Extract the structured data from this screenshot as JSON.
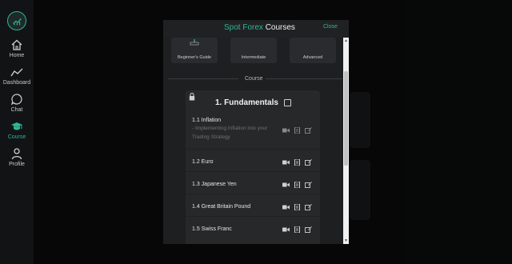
{
  "sidebar": {
    "items": [
      {
        "label": "Home",
        "icon": "home-icon"
      },
      {
        "label": "Dashboard",
        "icon": "chart-line-icon"
      },
      {
        "label": "Chat",
        "icon": "chat-bubble-icon"
      },
      {
        "label": "Course",
        "icon": "graduation-cap-icon",
        "active": true
      },
      {
        "label": "Profile",
        "icon": "user-icon"
      }
    ]
  },
  "modal": {
    "title_accent": "Spot Forex",
    "title_rest": " Courses",
    "close_label": "Close",
    "levels": [
      {
        "label": "Beginner's Guide"
      },
      {
        "label": "Intermediate"
      },
      {
        "label": "Advanced"
      }
    ],
    "section_label": "Course",
    "course": {
      "title": "1. Fundamentals",
      "lessons": [
        {
          "title": "1.1 Inflation",
          "subtitle": "- Implementing Inflation into your Trading Strategy"
        },
        {
          "title": "1.2 Euro",
          "subtitle": ""
        },
        {
          "title": "1.3 Japanese Yen",
          "subtitle": ""
        },
        {
          "title": "1.4 Great Britain Pound",
          "subtitle": ""
        },
        {
          "title": "1.5 Swiss Franc",
          "subtitle": ""
        }
      ]
    }
  },
  "colors": {
    "accent": "#2fb596",
    "background": "#0d0e10",
    "card": "#27282a"
  }
}
